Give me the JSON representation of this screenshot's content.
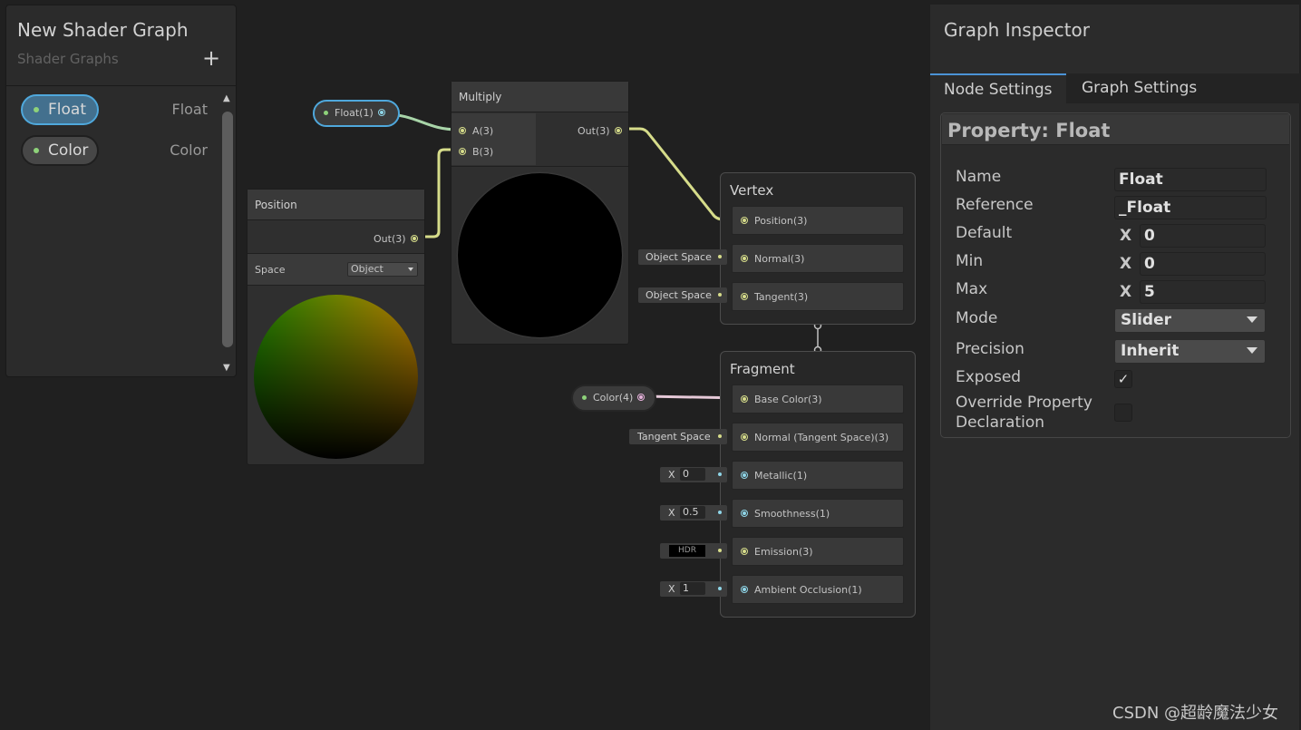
{
  "blackboard": {
    "title": "New Shader Graph",
    "subtitle": "Shader Graphs",
    "add_icon": "plus-icon",
    "properties": [
      {
        "name": "Float",
        "type": "Float",
        "selected": true
      },
      {
        "name": "Color",
        "type": "Color",
        "selected": false
      }
    ]
  },
  "nodes": {
    "float_property": {
      "label": "Float(1)"
    },
    "color_property": {
      "label": "Color(4)"
    },
    "multiply": {
      "title": "Multiply",
      "inputs": [
        "A(3)",
        "B(3)"
      ],
      "output": "Out(3)"
    },
    "position": {
      "title": "Position",
      "output": "Out(3)",
      "space_label": "Space",
      "space_value": "Object"
    }
  },
  "vertex": {
    "title": "Vertex",
    "blocks": [
      "Position(3)",
      "Normal(3)",
      "Tangent(3)"
    ],
    "inputs": [
      "Object Space",
      "Object Space"
    ]
  },
  "fragment": {
    "title": "Fragment",
    "blocks": [
      "Base Color(3)",
      "Normal (Tangent Space)(3)",
      "Metallic(1)",
      "Smoothness(1)",
      "Emission(3)",
      "Ambient Occlusion(1)"
    ],
    "tangent_input": "Tangent Space",
    "x_label": "X",
    "metallic": "0",
    "smoothness": "0.5",
    "emission": "HDR",
    "occlusion": "1"
  },
  "inspector": {
    "title": "Graph Inspector",
    "tabs": [
      "Node Settings",
      "Graph Settings"
    ],
    "active_tab": "Node Settings",
    "panel_title": "Property: Float",
    "labels": {
      "name": "Name",
      "reference": "Reference",
      "default": "Default",
      "min": "Min",
      "max": "Max",
      "mode": "Mode",
      "precision": "Precision",
      "exposed": "Exposed",
      "override_line1": "Override Property",
      "override_line2": "Declaration"
    },
    "x_label": "X",
    "values": {
      "name": "Float",
      "reference": "_Float",
      "default": "0",
      "min": "0",
      "max": "5",
      "mode": "Slider",
      "precision": "Inherit",
      "exposed": true,
      "override": false
    }
  },
  "watermark": "CSDN @超龄魔法少女",
  "colors": {
    "background": "#202020",
    "selection": "#4fa8dc",
    "port_yellow": "#d6dc8a",
    "port_cyan": "#8fd6e8",
    "port_pink": "#e6b2dc",
    "property_dot": "#8ed27a"
  }
}
